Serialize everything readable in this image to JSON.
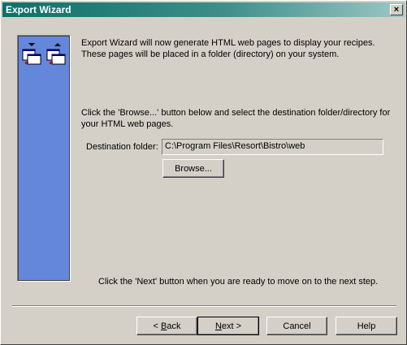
{
  "window": {
    "title": "Export Wizard",
    "close_glyph": "×"
  },
  "side_panel": {
    "icon": "export-computers-icon",
    "color": "#6487dc"
  },
  "content": {
    "intro_line1": "Export Wizard will now generate HTML web pages to display your recipes.",
    "intro_line2": "These pages will be placed in a folder (directory) on your system.",
    "instructions_line1": "Click the 'Browse...' button below and select the destination folder/directory for",
    "instructions_line2": "your HTML web pages.",
    "destination_label": "Destination folder:",
    "destination_value": "C:\\Program Files\\Resort\\Bistro\\web",
    "browse_label": "Browse...",
    "next_hint": "Click the 'Next' button when you are ready to move on to the next step."
  },
  "buttons": {
    "back_prefix": "< ",
    "back_accel": "B",
    "back_rest": "ack",
    "next_accel": "N",
    "next_rest": "ext >",
    "cancel": "Cancel",
    "help": "Help"
  }
}
